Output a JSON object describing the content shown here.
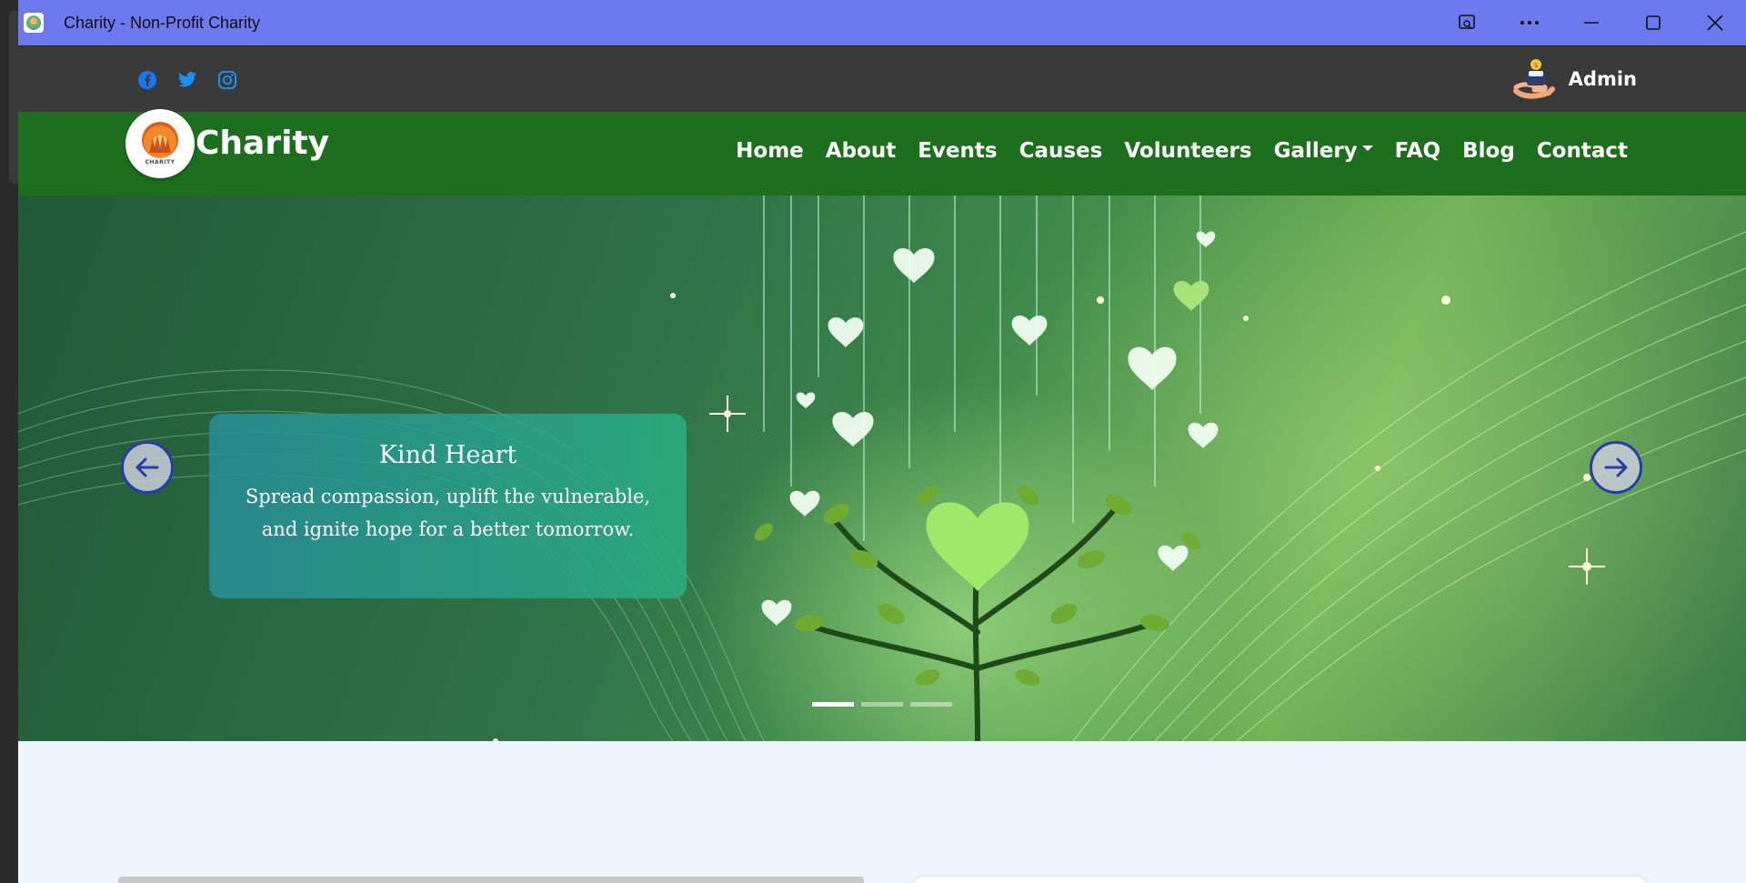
{
  "window": {
    "title": "Charity - Non-Profit Charity",
    "controls": [
      "app-options-icon",
      "more-icon",
      "minimize-icon",
      "maximize-icon",
      "close-icon"
    ]
  },
  "topbar": {
    "socials": [
      "facebook-icon",
      "twitter-icon",
      "instagram-icon"
    ],
    "social_color": "#1877f2",
    "admin_label": "Admin"
  },
  "navbar": {
    "brand": "Charity",
    "logo_text": "CHARITY",
    "background": "#1d6f1e",
    "items": [
      {
        "label": "Home"
      },
      {
        "label": "About"
      },
      {
        "label": "Events"
      },
      {
        "label": "Causes"
      },
      {
        "label": "Volunteers"
      },
      {
        "label": "Gallery",
        "dropdown": true
      },
      {
        "label": "FAQ"
      },
      {
        "label": "Blog"
      },
      {
        "label": "Contact"
      }
    ]
  },
  "hero": {
    "caption_title": "Kind Heart",
    "caption_text": "Spread compassion, uplift the vulnerable, and ignite hope for a better tomorrow.",
    "slide_count": 3,
    "active_slide": 1
  }
}
